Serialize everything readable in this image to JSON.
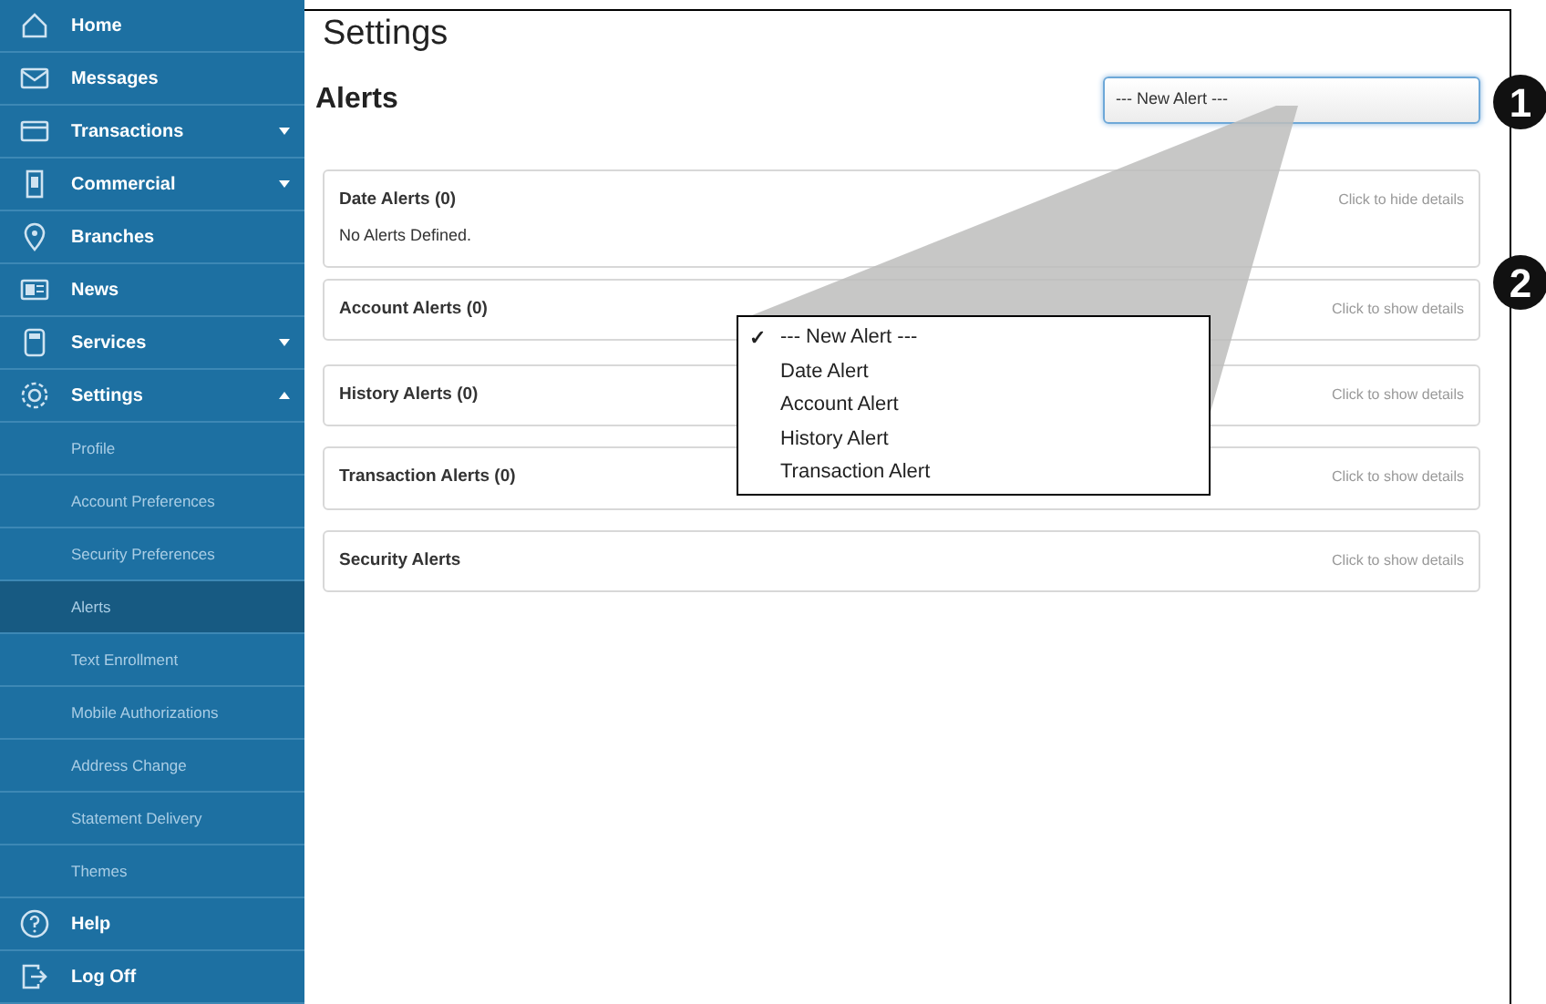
{
  "sidebar": {
    "items": [
      {
        "kind": "main",
        "label": "Home",
        "selected": false
      },
      {
        "kind": "main",
        "label": "Messages",
        "selected": false
      },
      {
        "kind": "main",
        "label": "Transactions",
        "selected": false,
        "expanded": false
      },
      {
        "kind": "main",
        "label": "Commercial",
        "selected": false,
        "expanded": false
      },
      {
        "kind": "main",
        "label": "Branches",
        "selected": false
      },
      {
        "kind": "main",
        "label": "News",
        "selected": false
      },
      {
        "kind": "main",
        "label": "Services",
        "selected": false,
        "expanded": false
      },
      {
        "kind": "main",
        "label": "Settings",
        "selected": false,
        "expanded": true
      },
      {
        "kind": "sub",
        "label": "Profile",
        "selected": false
      },
      {
        "kind": "sub",
        "label": "Account Preferences",
        "selected": false
      },
      {
        "kind": "sub",
        "label": "Security Preferences",
        "selected": false
      },
      {
        "kind": "sub",
        "label": "Alerts",
        "selected": true
      },
      {
        "kind": "sub",
        "label": "Text Enrollment",
        "selected": false
      },
      {
        "kind": "sub",
        "label": "Mobile Authorizations",
        "selected": false
      },
      {
        "kind": "sub",
        "label": "Address Change",
        "selected": false
      },
      {
        "kind": "sub",
        "label": "Statement Delivery",
        "selected": false
      },
      {
        "kind": "sub",
        "label": "Themes",
        "selected": false
      },
      {
        "kind": "main",
        "label": "Help",
        "selected": false
      },
      {
        "kind": "main",
        "label": "Log Off",
        "selected": false
      }
    ]
  },
  "page_title": "Settings",
  "section_title": "Alerts",
  "new_alert_select": {
    "value": "--- New Alert ---"
  },
  "panels": [
    {
      "title": "Date Alerts (0)",
      "toggle": "Click to hide details",
      "body": "No Alerts Defined."
    },
    {
      "title": "Account Alerts (0)",
      "toggle": "Click to show details"
    },
    {
      "title": "History Alerts (0)",
      "toggle": "Click to show details"
    },
    {
      "title": "Transaction Alerts (0)",
      "toggle": "Click to show details"
    },
    {
      "title": "Security Alerts",
      "toggle": "Click to show details"
    }
  ],
  "dropdown": {
    "options": [
      {
        "label": "--- New Alert ---",
        "selected": true
      },
      {
        "label": "Date Alert",
        "selected": false
      },
      {
        "label": "Account Alert",
        "selected": false
      },
      {
        "label": "History Alert",
        "selected": false
      },
      {
        "label": "Transaction Alert",
        "selected": false
      }
    ],
    "check": "✓"
  },
  "callouts": [
    "1",
    "2"
  ]
}
